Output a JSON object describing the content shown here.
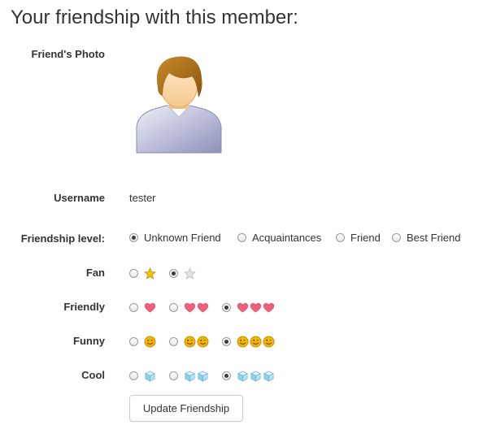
{
  "page": {
    "title": "Your friendship with this member:"
  },
  "photo": {
    "label": "Friend's Photo",
    "icon": "default-user-avatar"
  },
  "username": {
    "label": "Username",
    "value": "tester"
  },
  "friendship_level": {
    "label": "Friendship level:",
    "options": [
      "Unknown Friend",
      "Acquaintances",
      "Friend",
      "Best Friend"
    ],
    "selected": "Unknown Friend"
  },
  "ratings": [
    {
      "label": "Fan",
      "icon": "star-icon",
      "counts": [
        1,
        0
      ],
      "selected_index": 1,
      "color": "#f5c400"
    },
    {
      "label": "Friendly",
      "icon": "heart-icon",
      "counts": [
        1,
        2,
        3
      ],
      "selected_index": 2,
      "color": "#f0607a"
    },
    {
      "label": "Funny",
      "icon": "smiley-icon",
      "counts": [
        1,
        2,
        3
      ],
      "selected_index": 2,
      "color": "#f2b600"
    },
    {
      "label": "Cool",
      "icon": "ice-cube-icon",
      "counts": [
        1,
        2,
        3
      ],
      "selected_index": 2,
      "color": "#8fd0f0"
    }
  ],
  "actions": {
    "update_label": "Update Friendship"
  }
}
